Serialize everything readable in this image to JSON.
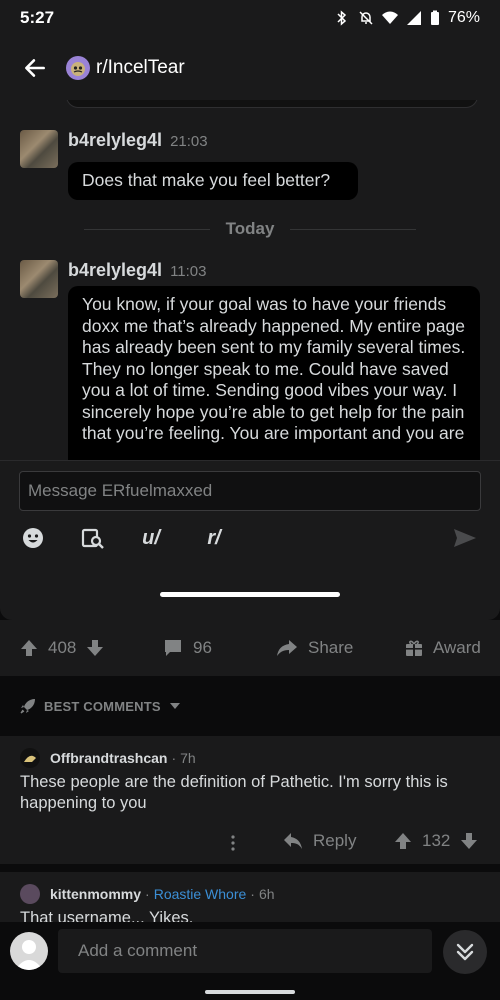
{
  "status_bar": {
    "time": "5:27",
    "battery": "76%"
  },
  "header": {
    "subreddit": "r/IncelTear"
  },
  "chat": {
    "messages": [
      {
        "username": "b4relyleg4l",
        "time": "21:03",
        "text": "Does that make you feel better?"
      },
      {
        "username": "b4relyleg4l",
        "time": "11:03",
        "text": "You know, if your goal was to have your friends doxx me that’s already happened. My entire page has already been sent to my family several times. They no longer speak to me. Could have saved you a lot of time. Sending good vibes your way. I sincerely hope you’re able to get help for the pain that you’re feeling. You are important and you are"
      }
    ],
    "day_divider": "Today",
    "composer_placeholder": "Message ERfuelmaxxed",
    "tools": {
      "user": "u/",
      "subreddit": "r/"
    }
  },
  "post_actions": {
    "score": "408",
    "comments": "96",
    "share": "Share",
    "award": "Award"
  },
  "sort": {
    "label": "BEST COMMENTS"
  },
  "comments": [
    {
      "username": "Offbrandtrashcan",
      "age": "7h",
      "body": "These people are the definition of Pathetic.  I'm sorry this is happening to you",
      "reply": "Reply",
      "score": "132"
    },
    {
      "username": "kittenmommy",
      "flair": "Roastie Whore",
      "age": "6h",
      "body": "That username... Yikes."
    }
  ],
  "footer": {
    "add_comment_placeholder": "Add a comment"
  },
  "colors": {
    "background": "#0b0b0c",
    "surface": "#1a1a1b",
    "text": "#d7dadc",
    "muted": "#818384",
    "flair": "#3b8fd6"
  }
}
